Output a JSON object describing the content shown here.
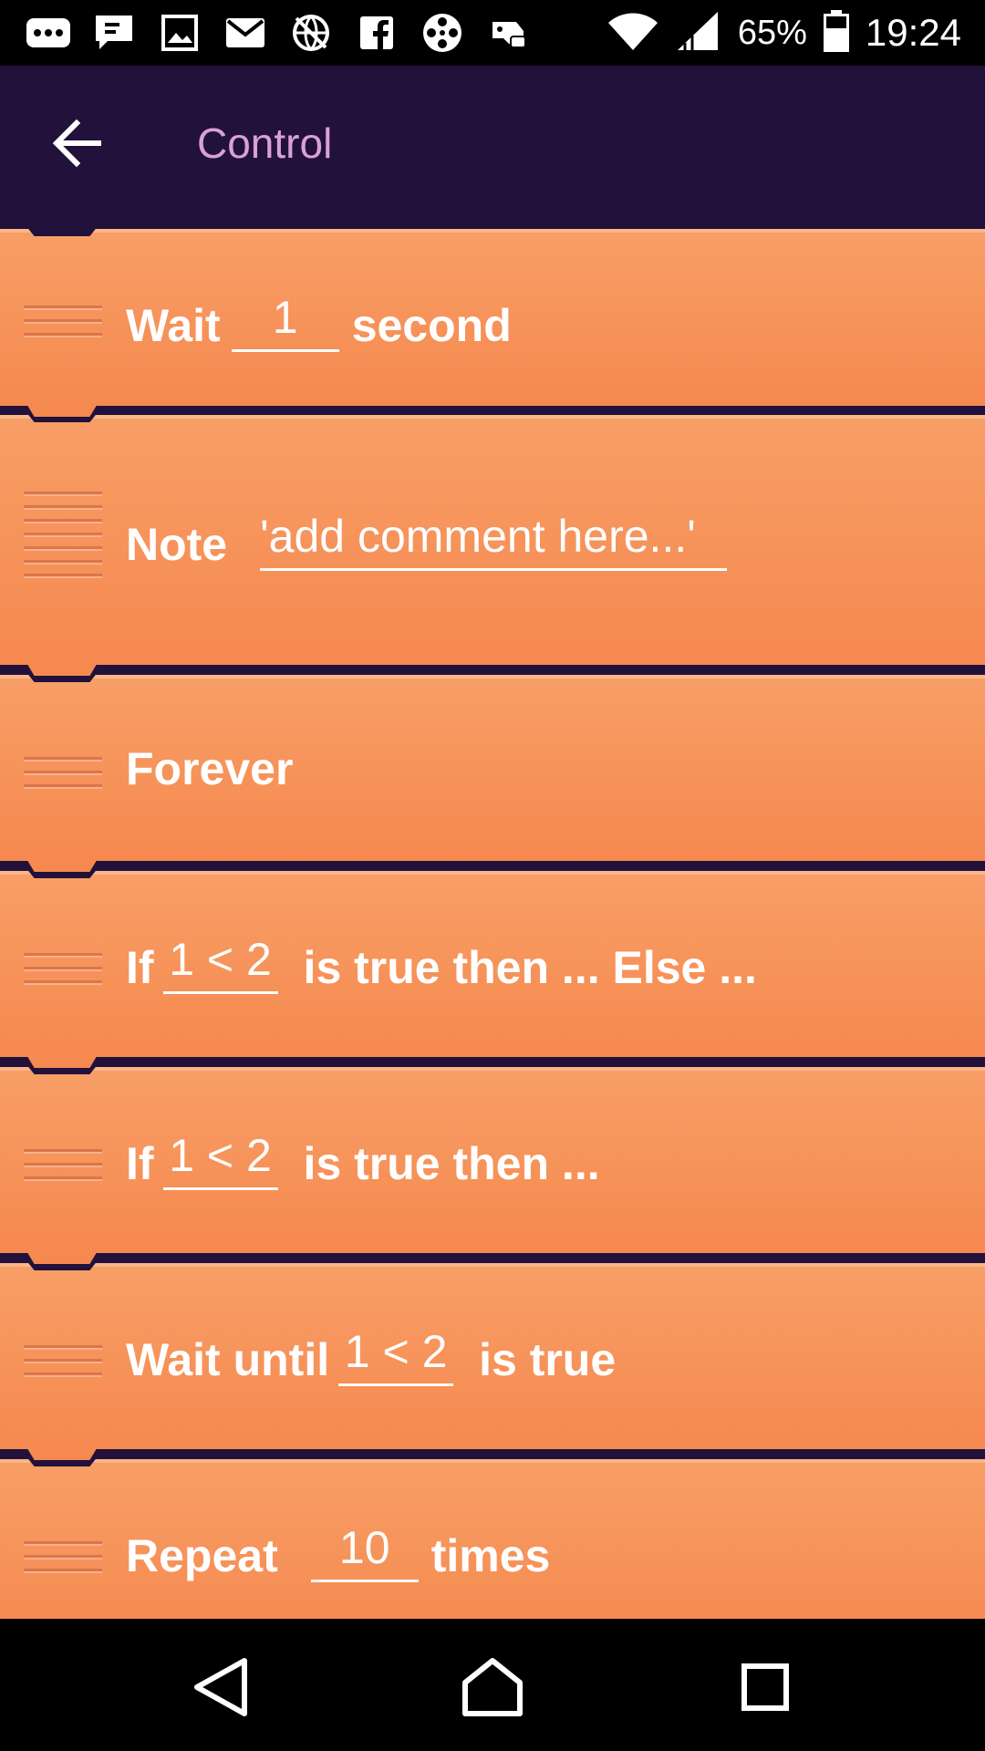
{
  "status_bar": {
    "icons": [
      "more-dots-icon",
      "chat-icon",
      "image-icon",
      "mail-icon",
      "vpn-globe-icon",
      "facebook-icon",
      "film-reel-icon",
      "game-controller-icon",
      "wifi-icon",
      "signal-icon",
      "battery-icon"
    ],
    "battery": "65%",
    "time": "19:24"
  },
  "app_bar": {
    "back_icon": "arrow-left-icon",
    "title": "Control"
  },
  "blocks": {
    "wait": {
      "label": "Wait",
      "value": "1",
      "suffix": "second"
    },
    "note": {
      "label": "Note",
      "value": "'add comment here...'"
    },
    "forever": {
      "label": "Forever"
    },
    "if_else": {
      "label": "If",
      "value": "1 < 2",
      "suffix": "is true then ... Else ..."
    },
    "if_then": {
      "label": "If",
      "value": "1 < 2",
      "suffix": "is true then ..."
    },
    "wait_until": {
      "label": "Wait until",
      "value": "1 < 2",
      "suffix": "is true"
    },
    "repeat": {
      "label": "Repeat",
      "value": "10",
      "suffix": "times"
    }
  },
  "nav_bar": {
    "icons": [
      "back-triangle-icon",
      "home-icon",
      "recents-square-icon"
    ]
  },
  "colors": {
    "block_top": "#f79e66",
    "block_bottom": "#f6894f",
    "app_bar": "#22113b",
    "title": "#d9a1d6"
  }
}
